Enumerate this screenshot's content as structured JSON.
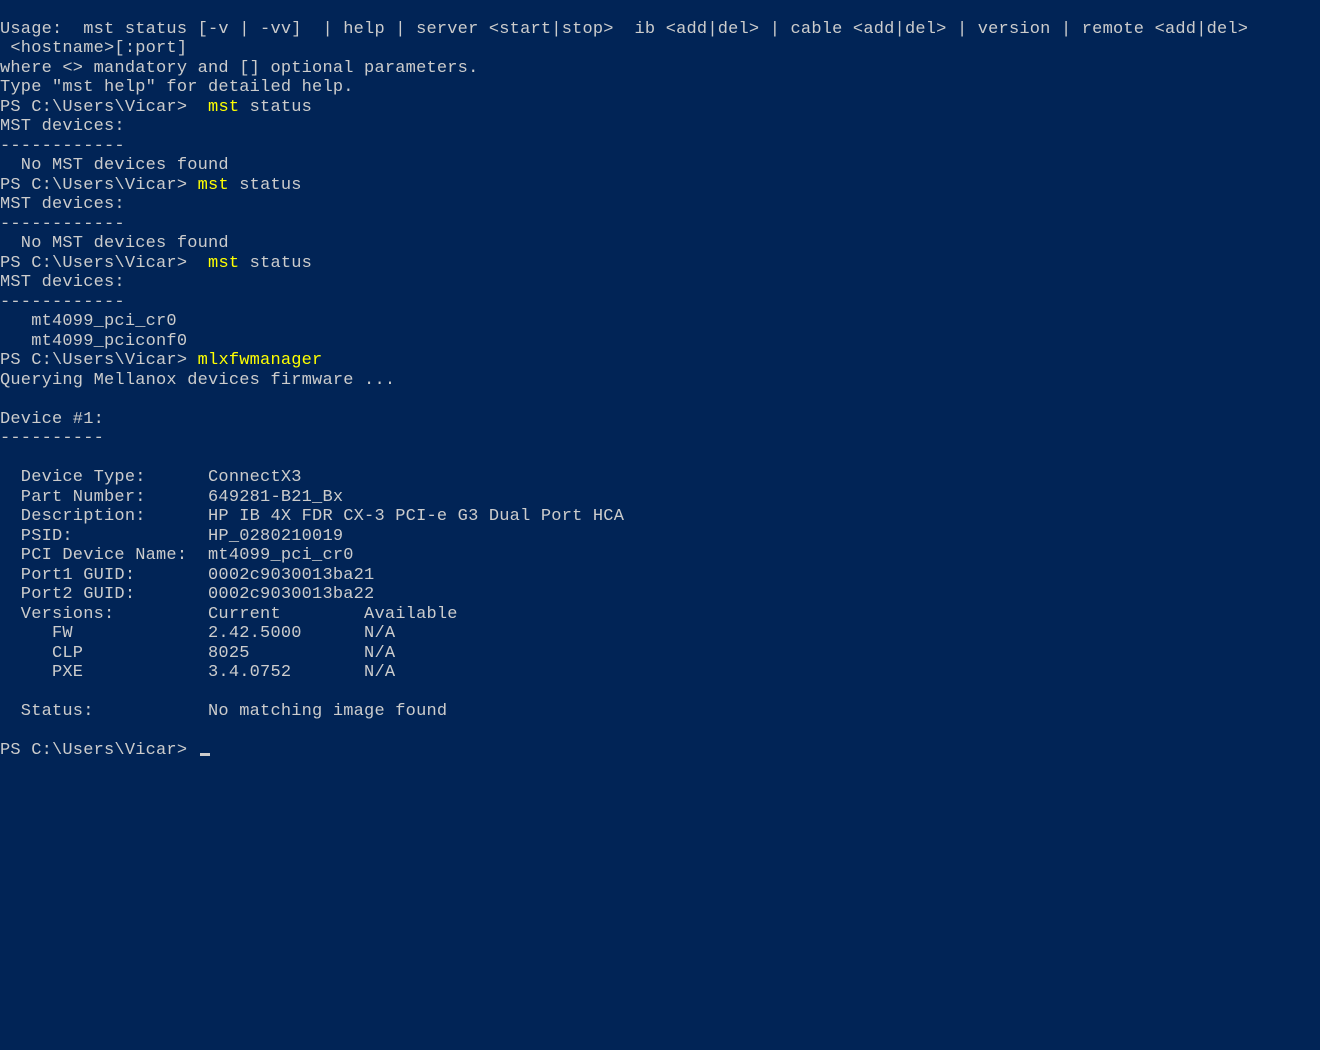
{
  "usage_line1": "Usage:  mst status [-v | -vv]  | help | server <start|stop>  ib <add|del> | cable <add|del> | version | remote <add|del>",
  "usage_line2": " <hostname>[:port]",
  "usage_line3": "where <> mandatory and [] optional parameters.",
  "usage_line4": "Type \"mst help\" for detailed help.",
  "prompt": "PS C:\\Users\\Vicar> ",
  "cmd1_pre": " mst",
  "cmd1_post": " status",
  "mst_devices_header": "MST devices:",
  "mst_divider": "------------",
  "mst_none_line": "  No MST devices found",
  "cmd2_pre": "mst",
  "cmd2_post": " status",
  "cmd3_pre": " mst",
  "cmd3_post": " status",
  "mst_dev_line1": "   mt4099_pci_cr0",
  "mst_dev_line2": "   mt4099_pciconf0",
  "cmd4": "mlxfwmanager",
  "querying": "Querying Mellanox devices firmware ...",
  "device_header": "Device #1:",
  "device_divider": "----------",
  "dev_type": "  Device Type:      ConnectX3",
  "part_number": "  Part Number:      649281-B21_Bx",
  "description": "  Description:      HP IB 4X FDR CX-3 PCI-e G3 Dual Port HCA",
  "psid": "  PSID:             HP_0280210019",
  "pci_dev_name": "  PCI Device Name:  mt4099_pci_cr0",
  "port1_guid": "  Port1 GUID:       0002c9030013ba21",
  "port2_guid": "  Port2 GUID:       0002c9030013ba22",
  "versions_hdr": "  Versions:         Current        Available",
  "ver_fw": "     FW             2.42.5000      N/A",
  "ver_clp": "     CLP            8025           N/A",
  "ver_pxe": "     PXE            3.4.0752       N/A",
  "status_line": "  Status:           No matching image found"
}
